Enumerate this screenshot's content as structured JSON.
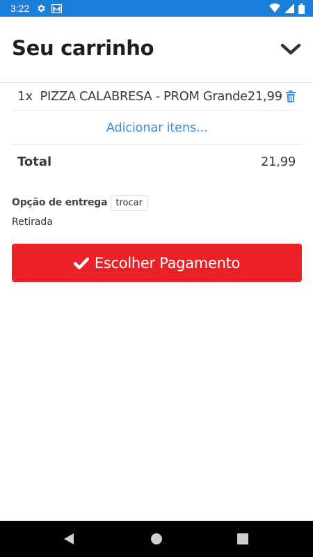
{
  "status_bar": {
    "time": "3:22",
    "background": "#1a7fd8",
    "icons": [
      "settings-icon",
      "gmail-icon",
      "wifi-icon",
      "signal-icon",
      "battery-icon"
    ]
  },
  "header": {
    "title": "Seu carrinho",
    "collapse_icon": "chevron-down-icon"
  },
  "cart": {
    "items": [
      {
        "qty": "1x",
        "name": "PIZZA CALABRESA - PROM Grande",
        "price": "21,99",
        "delete_icon": "trash-icon"
      }
    ],
    "add_items_label": "Adicionar itens...",
    "total_label": "Total",
    "total_value": "21,99"
  },
  "delivery": {
    "label": "Opção de entrega",
    "change_label": "trocar",
    "method": "Retirada"
  },
  "payment_button": {
    "label": "Escolher Pagamento",
    "icon": "check-icon",
    "color": "#ea2227"
  },
  "nav_bar": {
    "buttons": [
      "back-icon",
      "home-icon",
      "recents-icon"
    ]
  },
  "colors": {
    "accent_link": "#3d8fd6",
    "primary_button": "#ea2227",
    "status_bar": "#1a7fd8"
  }
}
